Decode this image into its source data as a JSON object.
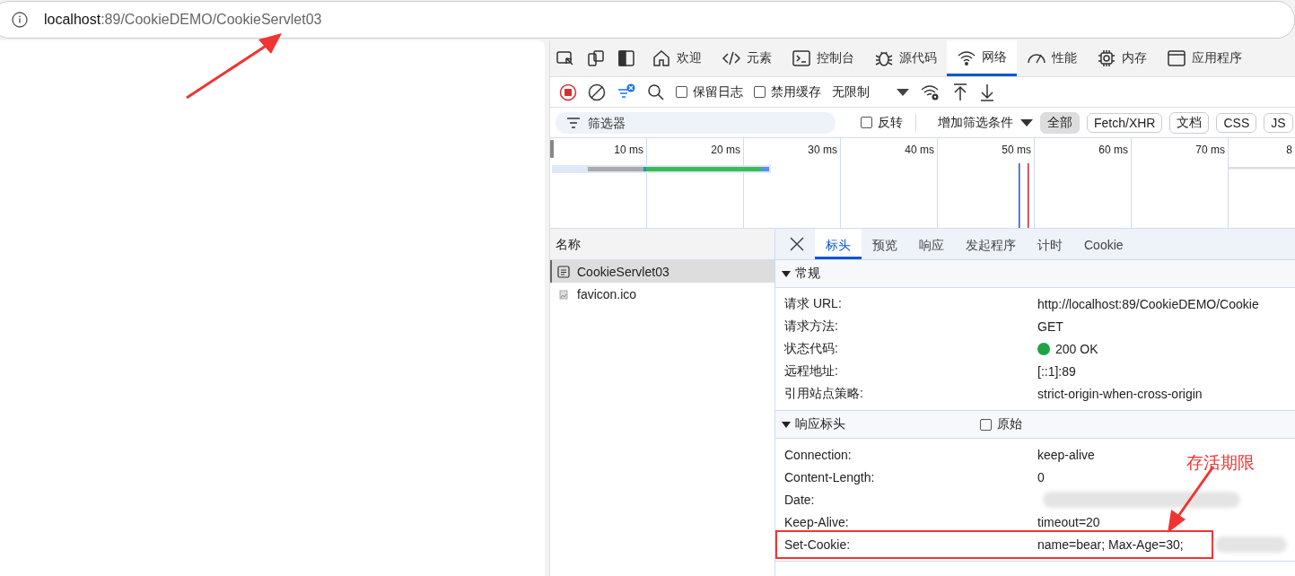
{
  "address_bar": {
    "host": "localhost",
    "path": ":89/CookieDEMO/CookieServlet03"
  },
  "devtools": {
    "tabs": [
      {
        "label": "欢迎",
        "selected": false
      },
      {
        "label": "元素",
        "selected": false
      },
      {
        "label": "控制台",
        "selected": false
      },
      {
        "label": "源代码",
        "selected": false
      },
      {
        "label": "网络",
        "selected": true
      },
      {
        "label": "性能",
        "selected": false
      },
      {
        "label": "内存",
        "selected": false
      },
      {
        "label": "应用程序",
        "selected": false
      }
    ],
    "toolbar": {
      "recording": true,
      "preserve_log": {
        "label": "保留日志",
        "checked": false
      },
      "disable_cache": {
        "label": "禁用缓存",
        "checked": false
      },
      "throttling": "无限制"
    },
    "filter": {
      "placeholder": "筛选器",
      "invert": {
        "label": "反转",
        "checked": false
      },
      "more_filters": "增加筛选条件",
      "types": [
        {
          "label": "全部",
          "selected": true
        },
        {
          "label": "Fetch/XHR",
          "selected": false
        },
        {
          "label": "文档",
          "selected": false
        },
        {
          "label": "CSS",
          "selected": false
        },
        {
          "label": "JS",
          "selected": false
        }
      ]
    },
    "timeline": {
      "ticks": [
        "10 ms",
        "20 ms",
        "30 ms",
        "40 ms",
        "50 ms",
        "60 ms",
        "70 ms",
        "8"
      ]
    },
    "requests": {
      "header": "名称",
      "items": [
        {
          "name": "CookieServlet03",
          "kind": "document",
          "selected": true
        },
        {
          "name": "favicon.ico",
          "kind": "image",
          "selected": false
        }
      ]
    },
    "details": {
      "tabs": [
        {
          "label": "标头",
          "selected": true
        },
        {
          "label": "预览",
          "selected": false
        },
        {
          "label": "响应",
          "selected": false
        },
        {
          "label": "发起程序",
          "selected": false
        },
        {
          "label": "计时",
          "selected": false
        },
        {
          "label": "Cookie",
          "selected": false
        }
      ],
      "sections": [
        {
          "title": "常规",
          "expanded": true,
          "rows": [
            {
              "name": "请求 URL:",
              "value": "http://localhost:89/CookieDEMO/Cookie"
            },
            {
              "name": "请求方法:",
              "value": "GET"
            },
            {
              "name": "状态代码:",
              "value": "200 OK",
              "color": "#1ea446"
            },
            {
              "name": "远程地址:",
              "value": "[::1]:89"
            },
            {
              "name": "引用站点策略:",
              "value": "strict-origin-when-cross-origin"
            }
          ]
        },
        {
          "title": "响应标头",
          "expanded": true,
          "raw": {
            "label": "原始",
            "checked": false
          },
          "rows": [
            {
              "name": "Connection:",
              "value": "keep-alive"
            },
            {
              "name": "Content-Length:",
              "value": "0"
            },
            {
              "name": "Date:",
              "redacted": true
            },
            {
              "name": "Keep-Alive:",
              "value": "timeout=20"
            },
            {
              "name": "Set-Cookie:",
              "value": "name=bear; Max-Age=30;",
              "redacted": true,
              "boxed": true
            }
          ]
        }
      ]
    }
  },
  "annotation": {
    "label": "存活期限"
  }
}
